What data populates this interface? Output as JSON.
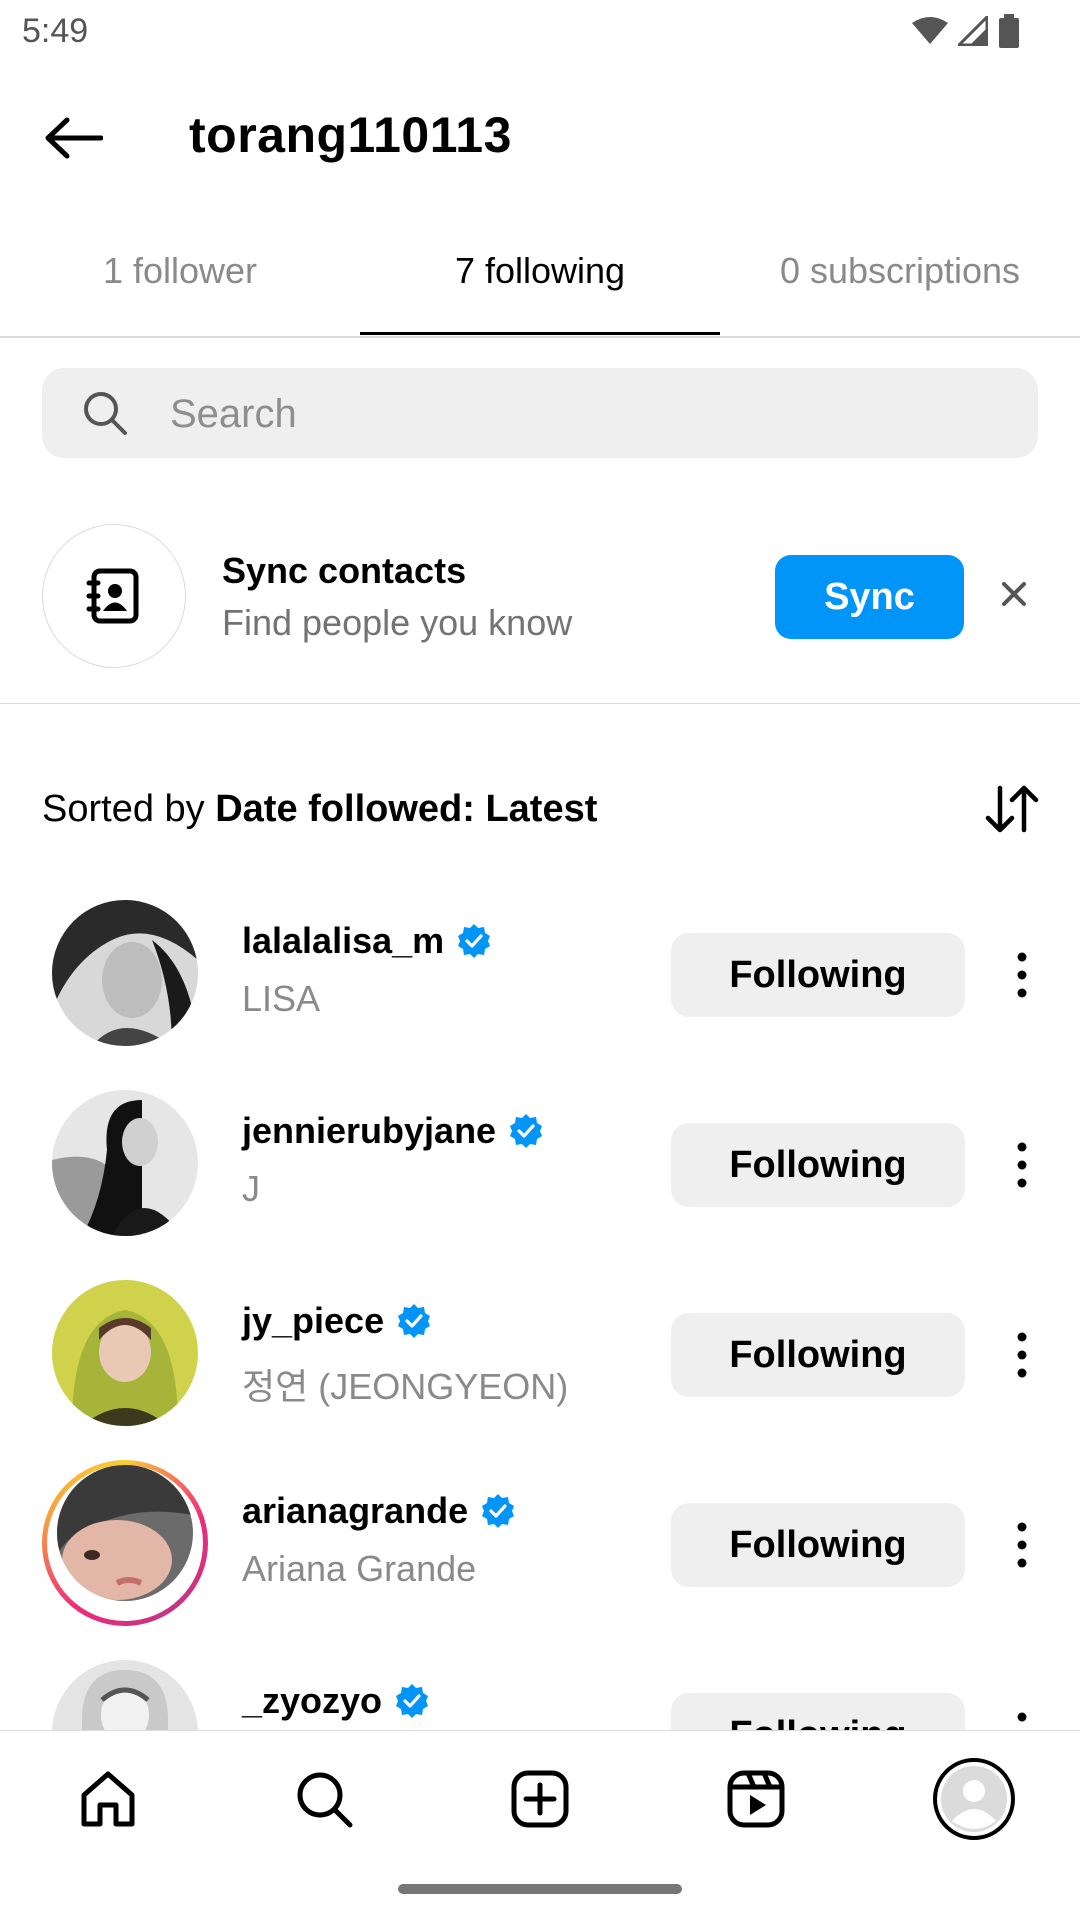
{
  "status_bar": {
    "time": "5:49",
    "icons": [
      "wifi-icon",
      "signal-icon",
      "battery-icon"
    ]
  },
  "header": {
    "title": "torang110113",
    "back_icon": "arrow-left-icon"
  },
  "tabs": [
    {
      "label": "1 follower",
      "active": false
    },
    {
      "label": "7 following",
      "active": true
    },
    {
      "label": "0 subscriptions",
      "active": false
    }
  ],
  "search": {
    "placeholder": "Search",
    "value": ""
  },
  "sync_contacts": {
    "title": "Sync contacts",
    "subtitle": "Find people you know",
    "button_label": "Sync",
    "icon": "contact-book-icon"
  },
  "sort": {
    "prefix": "Sorted by",
    "value": "Date followed: Latest",
    "icon": "sort-arrows-icon"
  },
  "users": [
    {
      "username": "lalalalisa_m",
      "full_name": "LISA",
      "verified": true,
      "button": "Following",
      "has_story": false
    },
    {
      "username": "jennierubyjane",
      "full_name": "J",
      "verified": true,
      "button": "Following",
      "has_story": false
    },
    {
      "username": "jy_piece",
      "full_name": "정연 (JEONGYEON)",
      "verified": true,
      "button": "Following",
      "has_story": false
    },
    {
      "username": "arianagrande",
      "full_name": "Ariana Grande",
      "verified": true,
      "button": "Following",
      "has_story": true
    },
    {
      "username": "_zyozyo",
      "full_name": "",
      "verified": true,
      "button": "Following",
      "has_story": false
    }
  ],
  "bottom_nav": [
    "home-icon",
    "search-icon",
    "create-icon",
    "reels-icon",
    "profile-icon"
  ],
  "colors": {
    "accent": "#0095f6",
    "verified": "#0095f6",
    "muted_text": "#8a8a8a",
    "button_bg": "#efefef"
  }
}
